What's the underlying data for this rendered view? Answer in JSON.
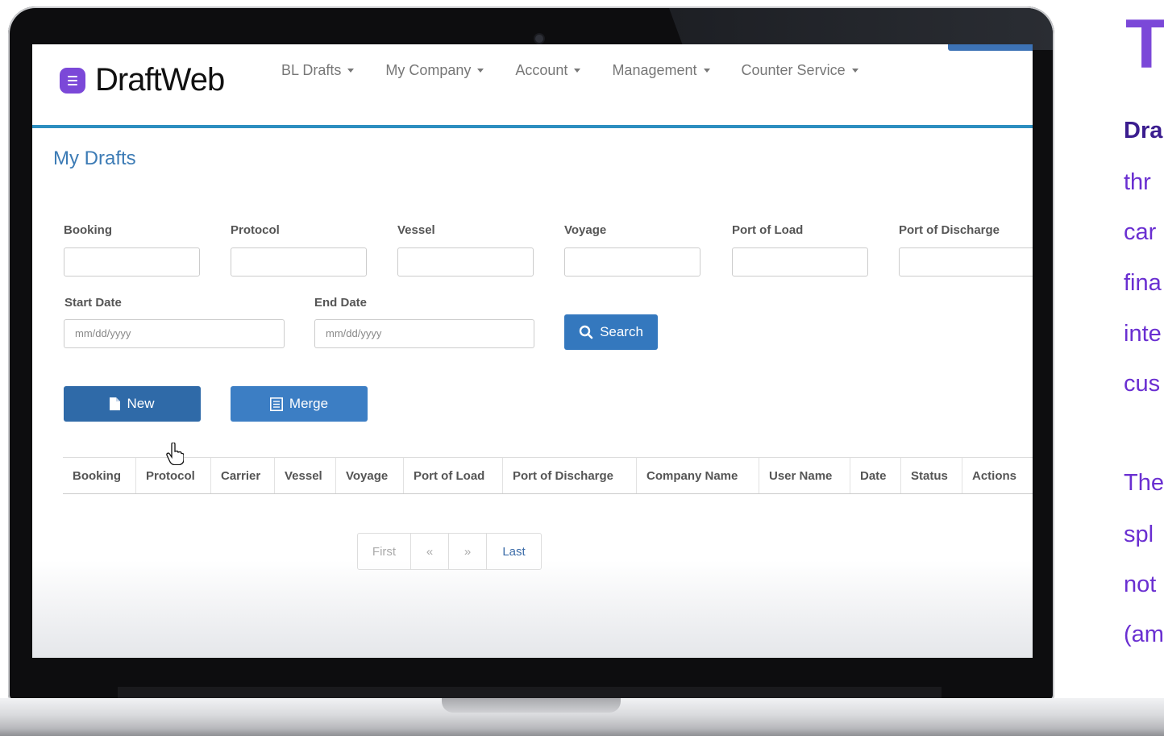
{
  "app": {
    "logo_text": "DraftWeb",
    "nav": [
      "BL Drafts",
      "My Company",
      "Account",
      "Management",
      "Counter Service"
    ]
  },
  "page": {
    "title": "My Drafts"
  },
  "filters": {
    "booking_label": "Booking",
    "protocol_label": "Protocol",
    "vessel_label": "Vessel",
    "voyage_label": "Voyage",
    "port_of_load_label": "Port of Load",
    "port_of_discharge_label": "Port of Discharge",
    "start_date_label": "Start Date",
    "end_date_label": "End Date",
    "date_placeholder": "mm/dd/yyyy",
    "search_label": "Search"
  },
  "actions": {
    "new_label": "New",
    "merge_label": "Merge"
  },
  "table": {
    "columns": [
      "Booking",
      "Protocol",
      "Carrier",
      "Vessel",
      "Voyage",
      "Port of Load",
      "Port of Discharge",
      "Company Name",
      "User Name",
      "Date",
      "Status",
      "Actions"
    ]
  },
  "pagination": [
    "First",
    "«",
    "»",
    "Last"
  ],
  "side_panel": {
    "heading": "T",
    "lines": [
      "Dra",
      "thr",
      "car",
      "fina",
      "inte",
      "cus",
      "The",
      "spl",
      "not",
      "(am"
    ]
  },
  "colors": {
    "accent": "#3478be",
    "brand": "#7b48d8",
    "nav_border": "#2d8ec0"
  }
}
